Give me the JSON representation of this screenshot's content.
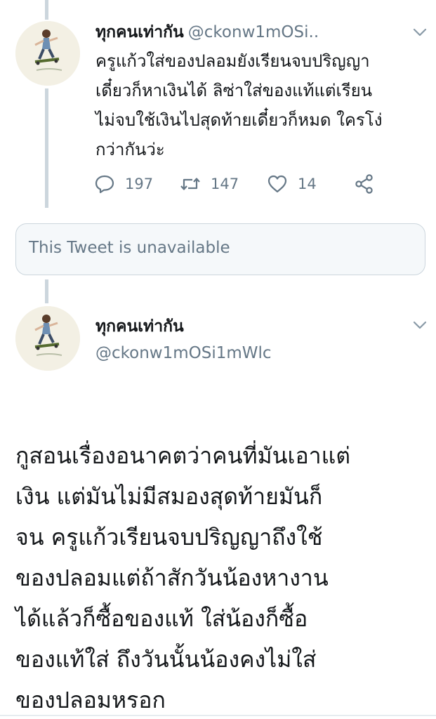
{
  "tweet1": {
    "name": "ทุกคนเท่ากัน",
    "handle": "@ckonw1mOSi..",
    "text_lines": [
      "ครูแก้วใส่ของปลอมยังเรียนจบปริญญา",
      "เดี๋ยวก็หาเงินได้ ลิซ่าใส่ของแท้แต่เรียน",
      "ไม่จบใช้เงินไปสุดท้ายเดี๋ยวก็หมด ใครโง่",
      "กว่ากันว่ะ"
    ],
    "replies": "197",
    "retweets": "147",
    "likes": "14",
    "icons": [
      "reply-icon",
      "retweet-icon",
      "like-icon",
      "share-icon",
      "chevron-down-icon"
    ]
  },
  "unavailable": {
    "text": "This Tweet is unavailable"
  },
  "tweet2": {
    "name": "ทุกคนเท่ากัน",
    "handle": "@ckonw1mOSi1mWlc",
    "text_lines": [
      "กูสอนเรื่องอนาคตว่าคนที่มันเอาแต่",
      "เงิน แต่มันไม่มีสมองสุดท้ายมันก็",
      "จน ครูแก้วเรียนจบปริญญาถึงใช้",
      "ของปลอมแต่ถ้าสักวันน้องหางาน",
      "ได้แล้วก็ซื้อของแท้ ใส่น้องก็ซื้อ",
      "ของแท้ใส่ ถึงวันนั้นน้องคงไม่ใส่",
      "ของปลอมหรอก"
    ]
  },
  "colors": {
    "text": "#14171a",
    "secondary": "#657786",
    "thread_line": "#ccd6dd",
    "card_bg": "#f5f8fa"
  }
}
